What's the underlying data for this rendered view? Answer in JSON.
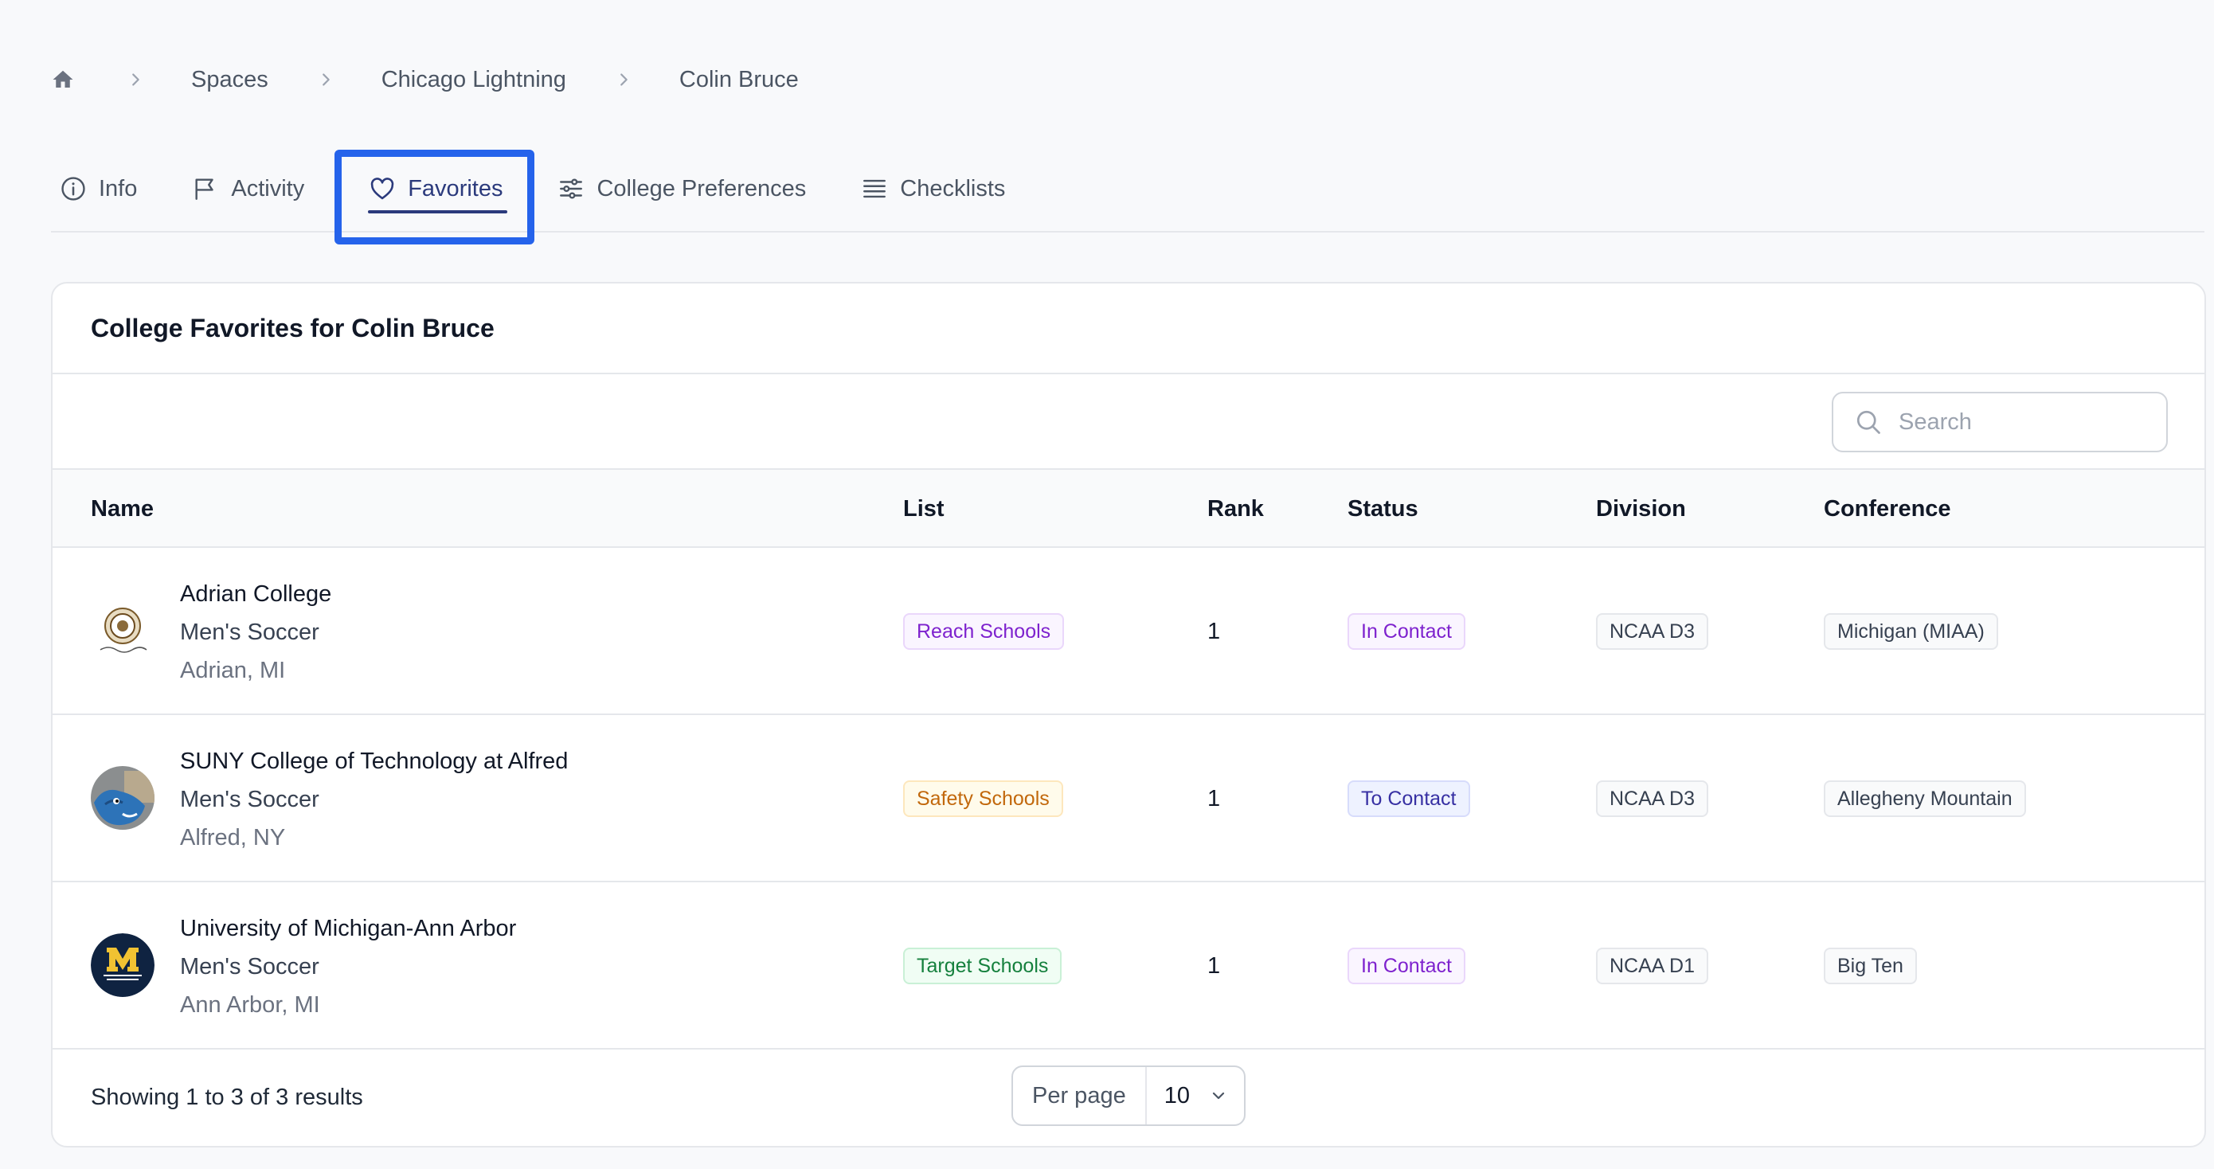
{
  "breadcrumb": {
    "home_icon": "home-icon",
    "items": [
      "Spaces",
      "Chicago Lightning",
      "Colin Bruce"
    ]
  },
  "tabs": [
    {
      "label": "Info",
      "icon": "info-icon"
    },
    {
      "label": "Activity",
      "icon": "flag-icon"
    },
    {
      "label": "Favorites",
      "icon": "heart-icon",
      "active": true
    },
    {
      "label": "College Preferences",
      "icon": "sliders-icon"
    },
    {
      "label": "Checklists",
      "icon": "list-icon"
    }
  ],
  "card": {
    "title": "College Favorites for Colin Bruce",
    "search_placeholder": "Search"
  },
  "table": {
    "headers": {
      "name": "Name",
      "list": "List",
      "rank": "Rank",
      "status": "Status",
      "division": "Division",
      "conference": "Conference"
    },
    "rows": [
      {
        "school": "Adrian College",
        "sport": "Men's Soccer",
        "location": "Adrian, MI",
        "list": "Reach Schools",
        "rank": "1",
        "status": "In Contact",
        "division": "NCAA D3",
        "conference": "Michigan (MIAA)"
      },
      {
        "school": "SUNY College of Technology at Alfred",
        "sport": "Men's Soccer",
        "location": "Alfred, NY",
        "list": "Safety Schools",
        "rank": "1",
        "status": "To Contact",
        "division": "NCAA D3",
        "conference": "Allegheny Mountain"
      },
      {
        "school": "University of Michigan-Ann Arbor",
        "sport": "Men's Soccer",
        "location": "Ann Arbor, MI",
        "list": "Target Schools",
        "rank": "1",
        "status": "In Contact",
        "division": "NCAA D1",
        "conference": "Big Ten"
      }
    ]
  },
  "footer": {
    "showing": "Showing 1 to 3 of 3 results",
    "per_page_label": "Per page",
    "per_page_value": "10"
  },
  "colors": {
    "active_tab": "#2b3a7c",
    "highlight": "#2563eb"
  }
}
